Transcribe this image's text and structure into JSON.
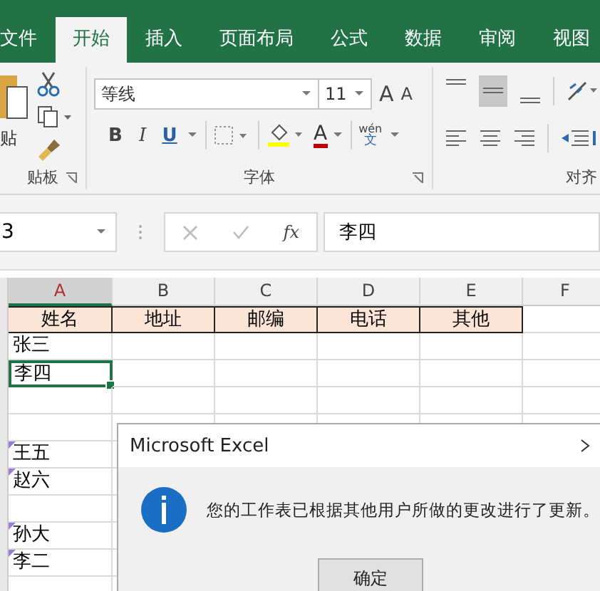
{
  "tabs": [
    {
      "label": "文件",
      "selected": false
    },
    {
      "label": "开始",
      "selected": true
    },
    {
      "label": "插入",
      "selected": false
    },
    {
      "label": "页面布局",
      "selected": false
    },
    {
      "label": "公式",
      "selected": false
    },
    {
      "label": "数据",
      "selected": false
    },
    {
      "label": "审阅",
      "selected": false
    },
    {
      "label": "视图",
      "selected": false
    }
  ],
  "ribbon": {
    "clipboard": {
      "paste_label": "贴",
      "group_label": "贴板"
    },
    "font": {
      "font_name": "等线",
      "font_size": "11",
      "grow": "A",
      "shrink": "A",
      "bold": "B",
      "italic": "I",
      "underline": "U",
      "font_color": "A",
      "phonetic_top": "wén",
      "phonetic_bottom": "文",
      "group_label": "字体"
    },
    "alignment": {
      "group_label": "对齐",
      "middle_align_on": true
    }
  },
  "formula_bar": {
    "name_box": "3",
    "fx": "fx",
    "value": "李四"
  },
  "columns": [
    {
      "label": "A",
      "selected": true
    },
    {
      "label": "B",
      "selected": false
    },
    {
      "label": "C",
      "selected": false
    },
    {
      "label": "D",
      "selected": false
    },
    {
      "label": "E",
      "selected": false
    },
    {
      "label": "F",
      "selected": false
    }
  ],
  "headers": [
    "姓名",
    "地址",
    "邮编",
    "电话",
    "其他"
  ],
  "rows": [
    {
      "name": "张三",
      "selected": false,
      "changed": false
    },
    {
      "name": "李四",
      "selected": true,
      "changed": false
    },
    {
      "selected": false,
      "changed": false
    },
    {
      "selected": false,
      "changed": false
    },
    {
      "name": "王五",
      "selected": false,
      "changed": true
    },
    {
      "name": "赵六",
      "selected": false,
      "changed": true
    },
    {
      "selected": false,
      "changed": false
    },
    {
      "name": "孙大",
      "selected": false,
      "changed": true
    },
    {
      "name": "李二",
      "selected": false,
      "changed": true
    },
    {
      "selected": false,
      "changed": false
    }
  ],
  "dialog": {
    "title": "Microsoft Excel",
    "kind": "info",
    "message": "您的工作表已根据其他用户所做的更改进行了更新。",
    "button": "确定"
  }
}
